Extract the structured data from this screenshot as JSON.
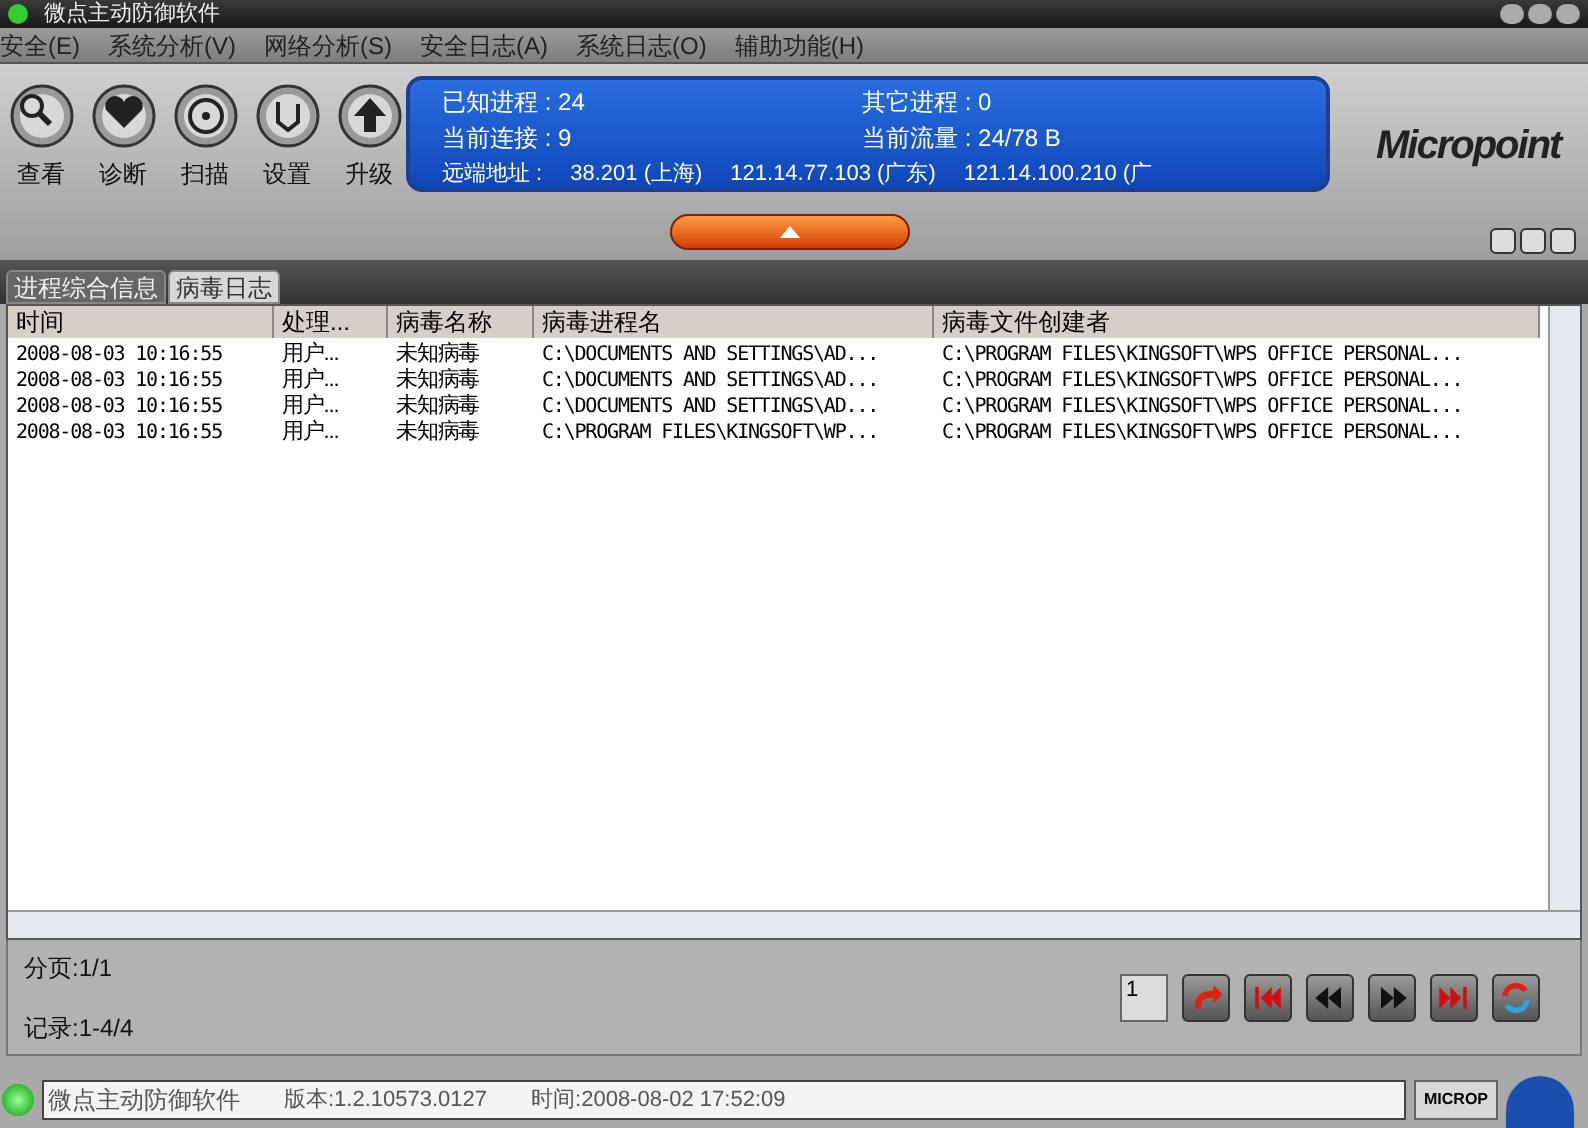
{
  "window": {
    "title": "微点主动防御软件"
  },
  "menu": [
    "安全(E)",
    "系统分析(V)",
    "网络分析(S)",
    "安全日志(A)",
    "系统日志(O)",
    "辅助功能(H)"
  ],
  "toolbar": [
    {
      "kind": "view",
      "label": "查看"
    },
    {
      "kind": "diagnose",
      "label": "诊断"
    },
    {
      "kind": "scan",
      "label": "扫描"
    },
    {
      "kind": "settings",
      "label": "设置"
    },
    {
      "kind": "upgrade",
      "label": "升级"
    }
  ],
  "info": {
    "known_label": "已知进程 :",
    "known": "24",
    "other_label": "其它进程 :",
    "other": "0",
    "conn_label": "当前连接 :",
    "conn": "9",
    "traffic_label": "当前流量 :",
    "traffic": "24/78 B",
    "remote_label": "远端地址 :",
    "remotes": [
      "38.201 (上海)",
      "121.14.77.103 (广东)",
      "121.14.100.210 (广"
    ]
  },
  "logo": "Micropoint",
  "tabs": [
    {
      "label": "进程综合信息",
      "selected": false
    },
    {
      "label": "病毒日志",
      "selected": true
    }
  ],
  "table": {
    "columns": [
      "时间",
      "处理...",
      "病毒名称",
      "病毒进程名",
      "病毒文件创建者"
    ],
    "rows": [
      [
        "2008-08-03 10:16:55",
        "用户...",
        "未知病毒",
        "C:\\DOCUMENTS AND SETTINGS\\AD...",
        "C:\\PROGRAM FILES\\KINGSOFT\\WPS OFFICE PERSONAL..."
      ],
      [
        "2008-08-03 10:16:55",
        "用户...",
        "未知病毒",
        "C:\\DOCUMENTS AND SETTINGS\\AD...",
        "C:\\PROGRAM FILES\\KINGSOFT\\WPS OFFICE PERSONAL..."
      ],
      [
        "2008-08-03 10:16:55",
        "用户...",
        "未知病毒",
        "C:\\DOCUMENTS AND SETTINGS\\AD...",
        "C:\\PROGRAM FILES\\KINGSOFT\\WPS OFFICE PERSONAL..."
      ],
      [
        "2008-08-03 10:16:55",
        "用户...",
        "未知病毒",
        "C:\\PROGRAM FILES\\KINGSOFT\\WP...",
        "C:\\PROGRAM FILES\\KINGSOFT\\WPS OFFICE PERSONAL..."
      ]
    ]
  },
  "pager": {
    "page": "分页:1/1",
    "records": "记录:1-4/4",
    "page_input": "1"
  },
  "status": {
    "app": "微点主动防御软件",
    "version": "版本:1.2.10573.0127",
    "time": "时间:2008-08-02 17:52:09",
    "badge": "MICROP"
  }
}
